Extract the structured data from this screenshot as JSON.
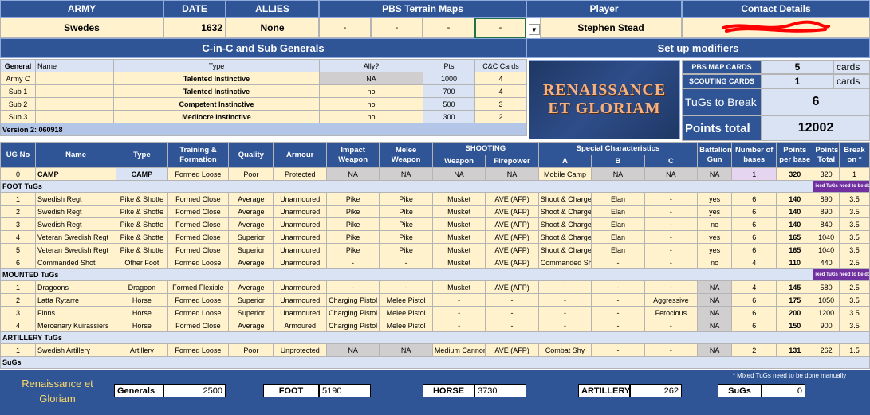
{
  "header": {
    "army_label": "ARMY",
    "date_label": "DATE",
    "allies_label": "ALLIES",
    "maps_label": "PBS Terrain Maps",
    "player_label": "Player",
    "contact_label": "Contact Details",
    "army": "Swedes",
    "date": "1632",
    "allies": "None",
    "maps": [
      "-",
      "-",
      "-",
      "-"
    ],
    "player": "Stephen Stead"
  },
  "cinc": {
    "title": "C-in-C and Sub Generals",
    "cols": [
      "General",
      "Name",
      "Type",
      "Ally?",
      "Pts",
      "C&C Cards"
    ],
    "rows": [
      {
        "general": "Army C",
        "name": "",
        "type": "Talented Instinctive",
        "ally": "NA",
        "pts": "1000",
        "cards": "4"
      },
      {
        "general": "Sub 1",
        "name": "",
        "type": "Talented Instinctive",
        "ally": "no",
        "pts": "700",
        "cards": "4"
      },
      {
        "general": "Sub 2",
        "name": "",
        "type": "Competent Instinctive",
        "ally": "no",
        "pts": "500",
        "cards": "3"
      },
      {
        "general": "Sub 3",
        "name": "",
        "type": "Mediocre Instinctive",
        "ally": "no",
        "pts": "300",
        "cards": "2"
      }
    ],
    "version": "Version 2: 060918"
  },
  "setup": {
    "title": "Set up modifiers",
    "logo_line1": "Renaissance",
    "logo_line2": "et Gloriam",
    "map_cards_label": "PBS MAP CARDS",
    "map_cards": "5",
    "map_cards_unit": "cards",
    "scout_cards_label": "SCOUTING CARDS",
    "scout_cards": "1",
    "scout_cards_unit": "cards",
    "tugs_label": "TuGs to Break",
    "tugs": "6",
    "points_label": "Points total",
    "points": "12002"
  },
  "table": {
    "headers": {
      "ug": "UG No",
      "name": "Name",
      "type": "Type",
      "training": "Training & Formation",
      "quality": "Quality",
      "armour": "Armour",
      "impact": "Impact Weapon",
      "melee": "Melee Weapon",
      "shooting": "SHOOTING",
      "weapon": "Weapon",
      "firepower": "Firepower",
      "special": "Special Characteristics",
      "a": "A",
      "b": "B",
      "c": "C",
      "bgun": "Battalion Gun",
      "bases": "Number of bases",
      "ppb": "Points per base",
      "total": "Points Total",
      "breakon": "Break on *"
    },
    "camp": [
      "0",
      "CAMP",
      "CAMP",
      "Formed Loose",
      "Poor",
      "Protected",
      "NA",
      "NA",
      "NA",
      "NA",
      "Mobile Camp",
      "NA",
      "NA",
      "NA",
      "1",
      "320",
      "320",
      "1"
    ],
    "foot_label": "FOOT TuGs",
    "mixed_note": "ixed TuGs need to be done manu",
    "foot": [
      [
        "1",
        "Swedish Regt",
        "Pike & Shotte",
        "Formed Close",
        "Average",
        "Unarmoured",
        "Pike",
        "Pike",
        "Musket",
        "AVE (AFP)",
        "Shoot & Charge",
        "Elan",
        "-",
        "yes",
        "6",
        "140",
        "890",
        "3.5"
      ],
      [
        "2",
        "Swedish Regt",
        "Pike & Shotte",
        "Formed Close",
        "Average",
        "Unarmoured",
        "Pike",
        "Pike",
        "Musket",
        "AVE (AFP)",
        "Shoot & Charge",
        "Elan",
        "-",
        "yes",
        "6",
        "140",
        "890",
        "3.5"
      ],
      [
        "3",
        "Swedish Regt",
        "Pike & Shotte",
        "Formed Close",
        "Average",
        "Unarmoured",
        "Pike",
        "Pike",
        "Musket",
        "AVE (AFP)",
        "Shoot & Charge",
        "Elan",
        "-",
        "no",
        "6",
        "140",
        "840",
        "3.5"
      ],
      [
        "4",
        "Veteran Swedish Regt",
        "Pike & Shotte",
        "Formed Close",
        "Superior",
        "Unarmoured",
        "Pike",
        "Pike",
        "Musket",
        "AVE (AFP)",
        "Shoot & Charge",
        "Elan",
        "-",
        "yes",
        "6",
        "165",
        "1040",
        "3.5"
      ],
      [
        "5",
        "Veteran Swedish Regt",
        "Pike & Shotte",
        "Formed Close",
        "Superior",
        "Unarmoured",
        "Pike",
        "Pike",
        "Musket",
        "AVE (AFP)",
        "Shoot & Charge",
        "Elan",
        "-",
        "yes",
        "6",
        "165",
        "1040",
        "3.5"
      ],
      [
        "6",
        "Commanded Shot",
        "Other Foot",
        "Formed Loose",
        "Average",
        "Unarmoured",
        "-",
        "-",
        "Musket",
        "AVE (AFP)",
        "Commanded Shot",
        "-",
        "-",
        "no",
        "4",
        "110",
        "440",
        "2.5"
      ]
    ],
    "mounted_label": "MOUNTED TuGs",
    "mounted": [
      [
        "1",
        "Dragoons",
        "Dragoon",
        "Formed Flexible",
        "Average",
        "Unarmoured",
        "-",
        "-",
        "Musket",
        "AVE (AFP)",
        "-",
        "-",
        "-",
        "NA",
        "4",
        "145",
        "580",
        "2.5"
      ],
      [
        "2",
        "Latta Rytarre",
        "Horse",
        "Formed Loose",
        "Superior",
        "Unarmoured",
        "Charging Pistol",
        "Melee Pistol",
        "-",
        "-",
        "-",
        "-",
        "Aggressive",
        "NA",
        "6",
        "175",
        "1050",
        "3.5"
      ],
      [
        "3",
        "Finns",
        "Horse",
        "Formed Loose",
        "Superior",
        "Unarmoured",
        "Charging Pistol",
        "Melee Pistol",
        "-",
        "-",
        "-",
        "-",
        "Ferocious",
        "NA",
        "6",
        "200",
        "1200",
        "3.5"
      ],
      [
        "4",
        "Mercenary Kuirassiers",
        "Horse",
        "Formed Close",
        "Average",
        "Armoured",
        "Charging Pistol",
        "Melee Pistol",
        "-",
        "-",
        "-",
        "-",
        "-",
        "NA",
        "6",
        "150",
        "900",
        "3.5"
      ]
    ],
    "artillery_label": "ARTILLERY TuGs",
    "artillery": [
      [
        "1",
        "Swedish Artillery",
        "Artillery",
        "Formed Loose",
        "Poor",
        "Unprotected",
        "NA",
        "NA",
        "Medium Cannon",
        "AVE (AFP)",
        "Combat Shy",
        "-",
        "-",
        "NA",
        "2",
        "131",
        "262",
        "1.5"
      ]
    ],
    "sugs_label": "SuGs"
  },
  "footer": {
    "brand": "Renaissance et Gloriam",
    "generals_label": "Generals",
    "generals": "2500",
    "foot_label": "FOOT",
    "foot": "5190",
    "horse_label": "HORSE",
    "horse": "3730",
    "artillery_label": "ARTILLERY",
    "artillery": "262",
    "sugs_label": "SuGs",
    "sugs": "0",
    "note": "* Mixed TuGs need to be done manually"
  },
  "colors": {
    "header_blue": "#2f5597",
    "cell_yellow": "#fff2cc",
    "brand_yellow": "#ffd966",
    "contact_scribble": "#ff0000"
  }
}
